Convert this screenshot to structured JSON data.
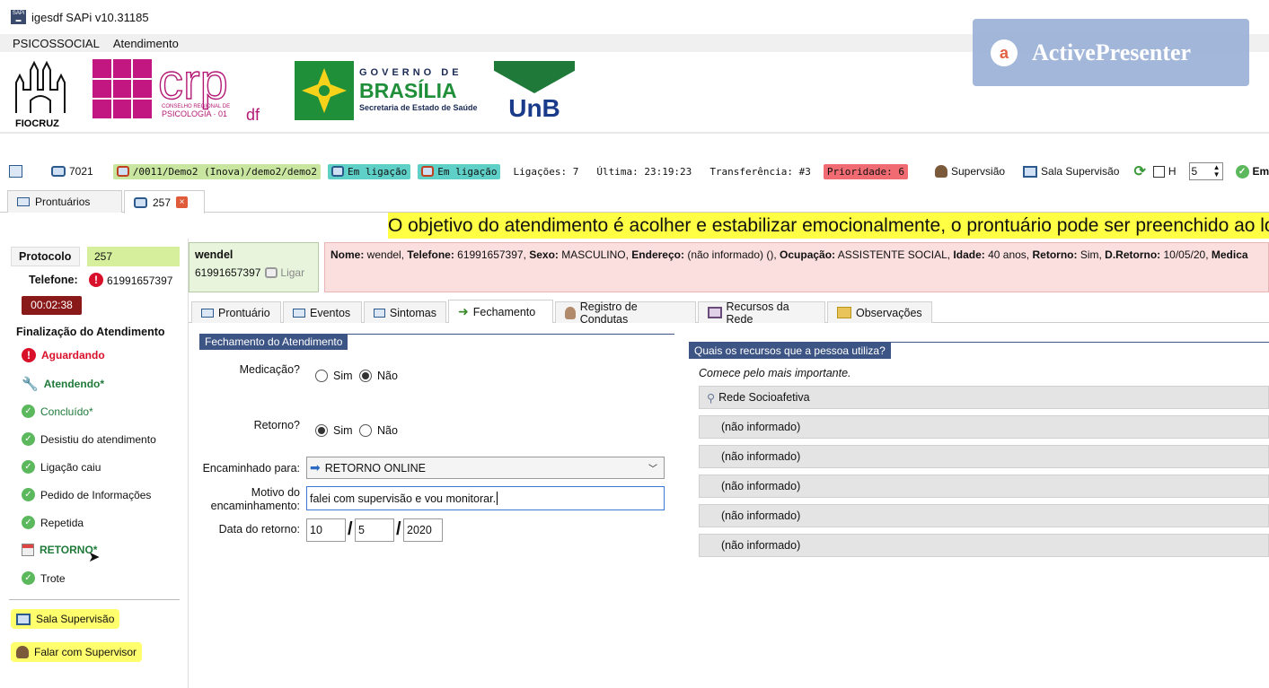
{
  "window": {
    "title": "igesdf SAPi v10.31185"
  },
  "menu": {
    "items": [
      "PSICOSSOCIAL",
      "Atendimento"
    ]
  },
  "logos": {
    "fiocruz": "FIOCRUZ",
    "crp_line1": "CONSELHO REGIONAL DE",
    "crp_line2": "PSICOLOGIA · 01",
    "crp_df": "df",
    "gov_line1": "GOVERNO DE",
    "gov_line2": "BRASÍLIA",
    "gov_line3": "Secretaria de Estado de Saúde",
    "unb": "UnB"
  },
  "overlay": {
    "text": "ActivePresenter"
  },
  "toolbar": {
    "extension": "7021",
    "queue": "/0011/Demo2 (Inova)/demo2/demo2",
    "status1": "Em ligação",
    "status2": "Em ligação",
    "ligacoes": "Ligações: 7",
    "ultima": "Última: 23:19:23",
    "transferencia": "Transferência: #3",
    "prioridade": "Prioridade: 6",
    "supervisao": "Supervsião",
    "sala": "Sala Supervisão",
    "h_label": "H",
    "spinner": "5",
    "em_s": "Em s"
  },
  "doc_tabs": [
    {
      "label": "Prontuários"
    },
    {
      "label": "257"
    }
  ],
  "banner": {
    "text": "O objetivo do atendimento é acolher e estabilizar emocionalmente, o prontuário pode ser preenchido ao lo"
  },
  "sidebar": {
    "protocolo_label": "Protocolo",
    "protocolo_value": "257",
    "telefone_label": "Telefone:",
    "telefone_value": "61991657397",
    "timer": "00:02:38",
    "finalizacao_title": "Finalização do Atendimento",
    "statuses": [
      "Aguardando",
      "Atendendo*",
      "Concluído*",
      "Desistiu do atendimento",
      "Ligação caiu",
      "Pedido de Informações",
      "Repetida",
      "RETORNO*",
      "Trote"
    ],
    "sala_btn": "Sala Supervisão",
    "falar_btn": "Falar com Supervisor"
  },
  "caller": {
    "name": "wendel",
    "phone": "61991657397",
    "ligar": "Ligar"
  },
  "infobar": {
    "nome_k": "Nome:",
    "nome_v": " wendel, ",
    "tel_k": "Telefone:",
    "tel_v": " 61991657397, ",
    "sexo_k": "Sexo:",
    "sexo_v": " MASCULINO, ",
    "end_k": "Endereço:",
    "end_v": " (não informado) (), ",
    "ocup_k": "Ocupação:",
    "ocup_v": " ASSISTENTE SOCIAL, ",
    "idade_k": "Idade:",
    "idade_v": " 40 anos, ",
    "ret_k": "Retorno:",
    "ret_v": " Sim, ",
    "dret_k": "D.Retorno:",
    "dret_v": " 10/05/20, ",
    "med_k": "Medica"
  },
  "sub_tabs": [
    "Prontuário",
    "Eventos",
    "Sintomas",
    "Fechamento",
    "Registro de Condutas",
    "Recursos da Rede",
    "Observações"
  ],
  "fechamento": {
    "header": "Fechamento do Atendimento",
    "medicacao_label": "Medicação?",
    "retorno_label": "Retorno?",
    "sim": "Sim",
    "nao": "Não",
    "encaminhado_label": "Encaminhado para:",
    "encaminhado_value": "RETORNO ONLINE",
    "motivo_label1": "Motivo do",
    "motivo_label2": "encaminhamento:",
    "motivo_value": "falei com supervisão e vou monitorar.",
    "data_label": "Data do retorno:",
    "day": "10",
    "month": "5",
    "year": "2020",
    "sep": "/"
  },
  "recursos": {
    "header": "Quais os recursos que a pessoa utiliza?",
    "hint": "Comece pelo mais importante.",
    "items": [
      "Rede Socioafetiva",
      "(não informado)",
      "(não informado)",
      "(não informado)",
      "(não informado)",
      "(não informado)"
    ]
  }
}
